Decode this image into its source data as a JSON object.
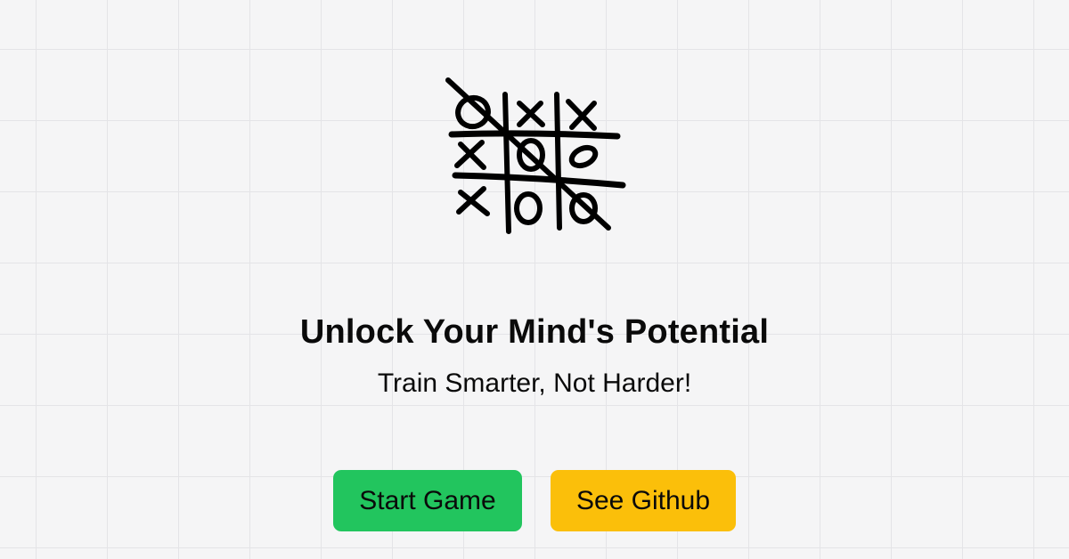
{
  "logo": {
    "icon": "tic-tac-toe-icon",
    "color": "#000000"
  },
  "hero": {
    "title": "Unlock Your Mind's Potential",
    "subtitle": "Train Smarter, Not Harder!"
  },
  "actions": {
    "start_label": "Start Game",
    "github_label": "See Github"
  },
  "colors": {
    "background": "#f5f5f6",
    "grid": "#e4e4e7",
    "start_button": "#22c55e",
    "github_button": "#fbbf0a",
    "text": "#0a0a0a"
  }
}
